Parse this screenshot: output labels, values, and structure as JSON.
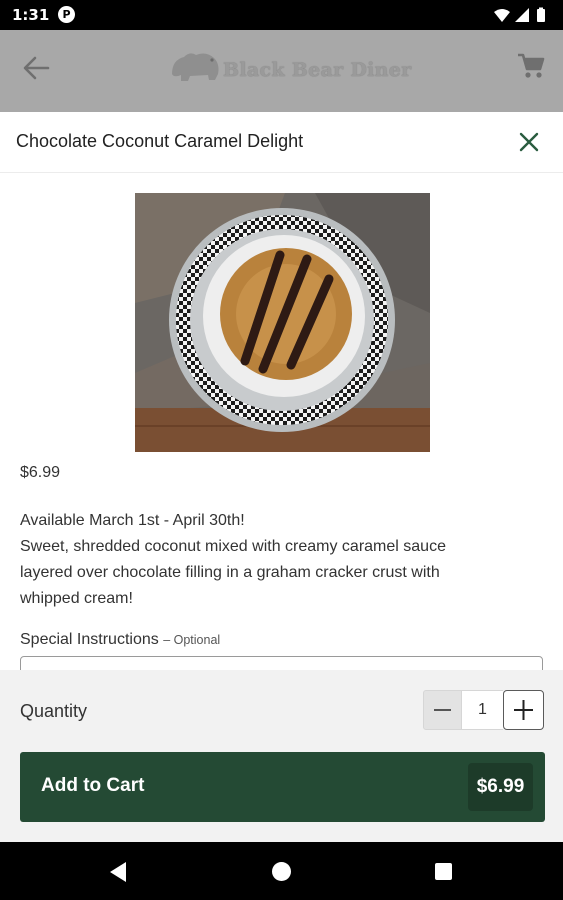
{
  "status_bar": {
    "time": "1:31",
    "notification_badge": "P",
    "icons": [
      "wifi-icon",
      "signal-icon",
      "battery-icon"
    ]
  },
  "app_header": {
    "brand_name": "Black Bear Diner",
    "icons": [
      "back-arrow-icon",
      "cart-icon"
    ]
  },
  "sheet": {
    "title": "Chocolate Coconut Caramel Delight",
    "close_icon": "close-icon",
    "price": "$6.99",
    "description_lines": [
      "Available March 1st - April 30th!",
      "Sweet, shredded coconut mixed with creamy caramel sauce",
      "layered over chocolate filling in a graham cracker crust with",
      "whipped cream!"
    ],
    "special_instructions": {
      "label": "Special Instructions",
      "optional": "– Optional",
      "value": ""
    }
  },
  "footer": {
    "quantity_label": "Quantity",
    "quantity_value": "1",
    "add_label": "Add to Cart",
    "add_price": "$6.99"
  },
  "colors": {
    "brand_green": "#244a34",
    "brand_green_dark": "#1d3b29",
    "close_icon": "#2a5c3f",
    "dim_overlay": "#a8a8a8"
  }
}
